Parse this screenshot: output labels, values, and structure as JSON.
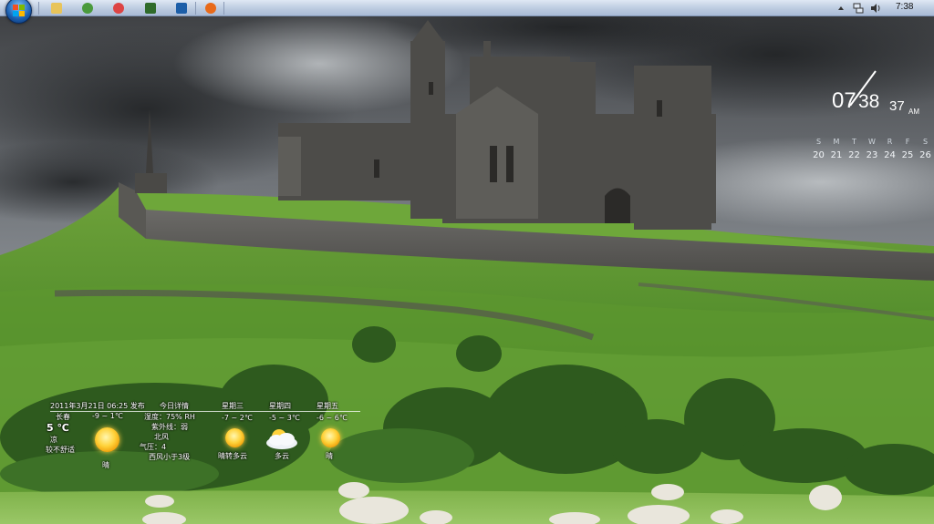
{
  "taskbar": {
    "start_label": "Start",
    "pinned_apps": [
      {
        "name": "windows-explorer",
        "color": "#e8c45a"
      },
      {
        "name": "chrome-green-app",
        "color": "#4a9a3c"
      },
      {
        "name": "chrome",
        "color": "#d44"
      },
      {
        "name": "dreamweaver",
        "color": "#2f6b2a"
      },
      {
        "name": "photoshop",
        "color": "#1c5ea8"
      },
      {
        "name": "firefox",
        "color": "#e86a1a"
      }
    ],
    "clock": "7:38"
  },
  "clock_gadget": {
    "hour": "07",
    "minute": "38",
    "second": "37",
    "ampm": "AM",
    "week_days": [
      "S",
      "M",
      "T",
      "W",
      "R",
      "F",
      "S"
    ],
    "dates": [
      "20",
      "21",
      "22",
      "23",
      "24",
      "25",
      "26"
    ]
  },
  "weather": {
    "updated": "2011年3月21日 06:25 发布",
    "city": "长春",
    "temp_now": "5 ℃",
    "feel": "凉",
    "comfort": "较不舒适",
    "today_range": "-9 ~ 1℃",
    "today_condition": "晴",
    "details_title": "今日详情",
    "humidity": "湿度：75% RH",
    "uv": "紫外线：弱",
    "wind_dir": "北风",
    "pressure": "气压：4",
    "wind": "西风小于3级",
    "forecast": [
      {
        "day": "星期三",
        "range": "-7 ~ 2℃",
        "condition": "晴转多云",
        "icon": "sun-icon"
      },
      {
        "day": "星期四",
        "range": "-5 ~ 3℃",
        "condition": "多云",
        "icon": "cloudy-icon"
      },
      {
        "day": "星期五",
        "range": "-6 ~ 6℃",
        "condition": "晴",
        "icon": "sun-icon"
      }
    ]
  }
}
